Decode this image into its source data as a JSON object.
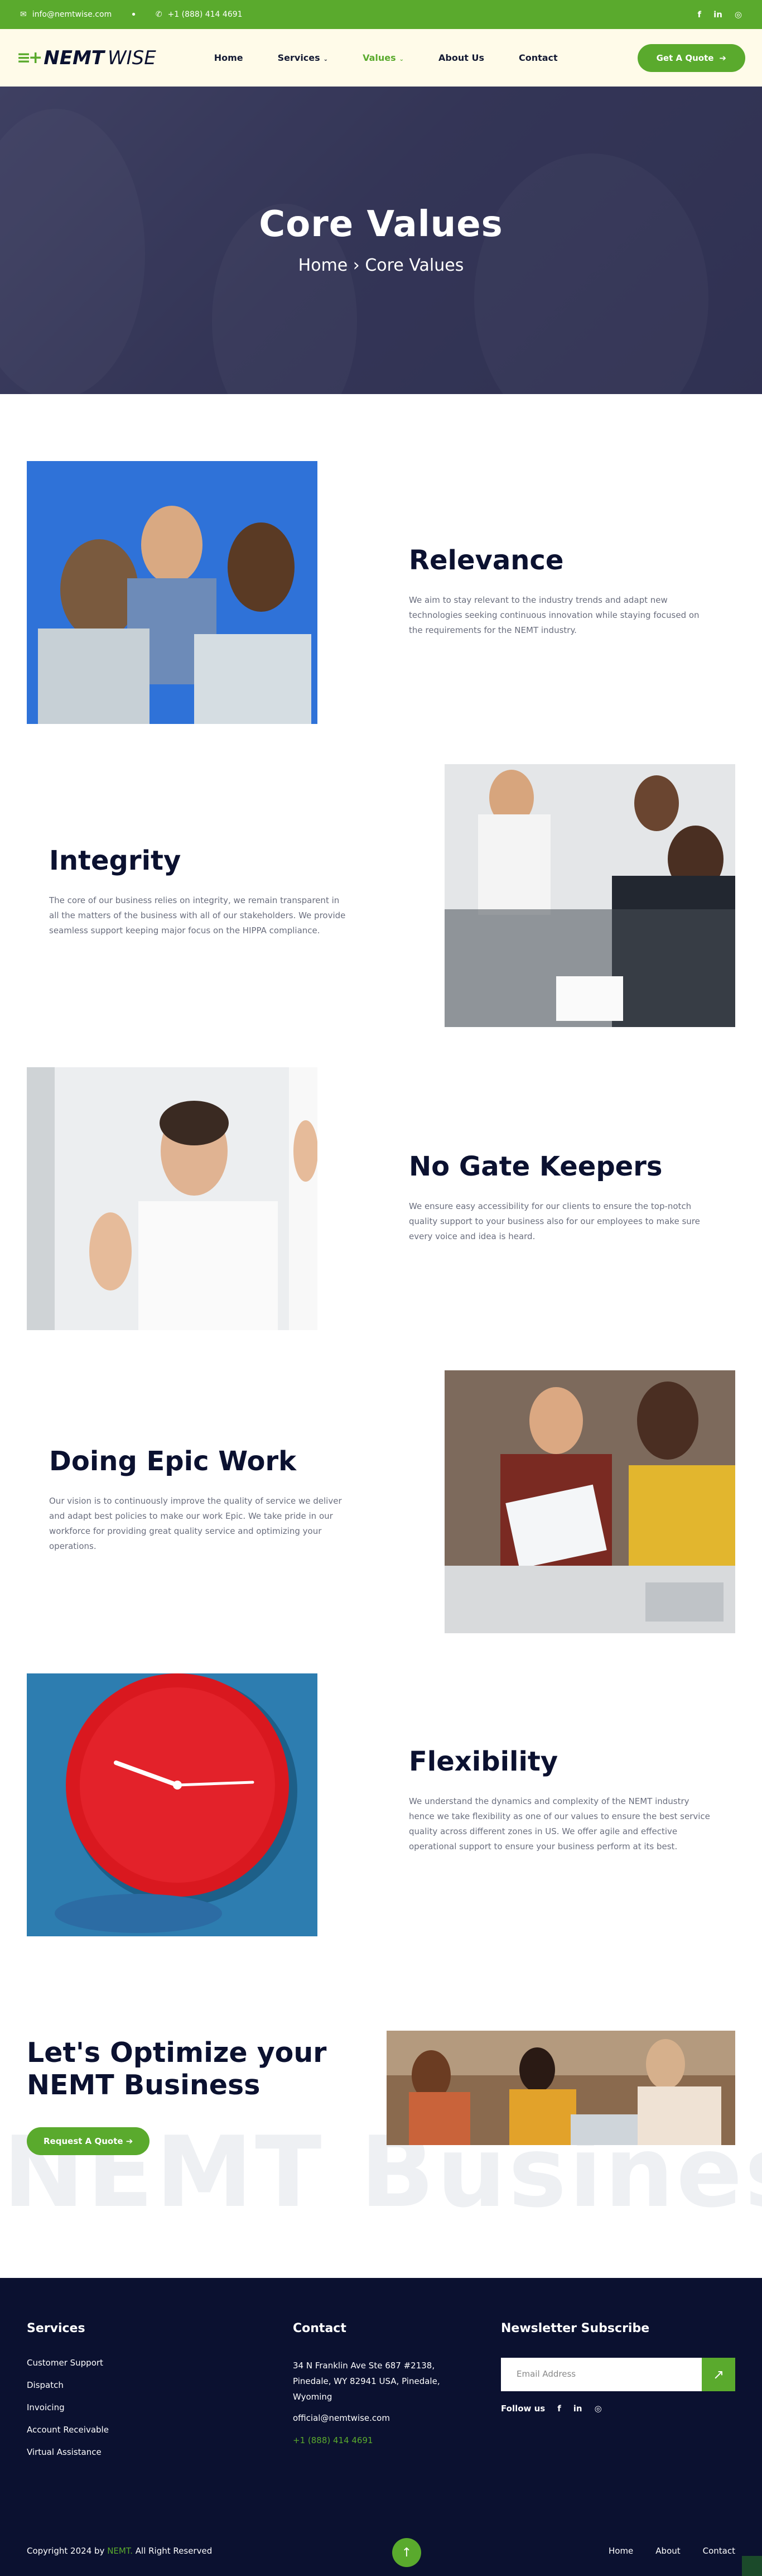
{
  "topbar": {
    "email": "info@nemtwise.com",
    "phone": "+1 (888) 414 4691",
    "socials": [
      "f",
      "in",
      "◎"
    ]
  },
  "header": {
    "logo_bold": "NEMT",
    "logo_light": "WISE",
    "nav": [
      {
        "label": "Home"
      },
      {
        "label": "Services"
      },
      {
        "label": "Values"
      },
      {
        "label": "About Us"
      },
      {
        "label": "Contact"
      }
    ],
    "cta": "Get A Quote"
  },
  "hero": {
    "title": "Core Values",
    "crumb_home": "Home",
    "crumb_current": "Core Values"
  },
  "values": [
    {
      "title": "Relevance",
      "text": "We aim to stay relevant to the industry trends and adapt new technologies seeking continuous innovation while staying focused on the requirements for the NEMT industry."
    },
    {
      "title": "Integrity",
      "text": "The core of our business relies on integrity, we remain transparent in all the matters of the business with all of our stakeholders. We provide seamless support keeping major focus on the HIPPA compliance."
    },
    {
      "title": "No Gate Keepers",
      "text": "We ensure easy accessibility for our clients to ensure the top-notch quality support to your business also for our employees to make sure every voice and idea is heard."
    },
    {
      "title": "Doing Epic Work",
      "text": "Our vision is to continuously improve the quality of service we deliver and adapt best policies to make our work Epic. We take pride in our workforce for providing great quality service and optimizing your operations."
    },
    {
      "title": "Flexibility",
      "text": "We understand the dynamics and complexity of the NEMT industry hence we take flexibility as one of our values to ensure the best service quality across different zones in US. We offer agile and effective operational support to ensure your business perform at its best."
    }
  ],
  "optimize": {
    "line1": "Let's Optimize your",
    "line2": "NEMT Business",
    "button": "Request A Quote",
    "ghost": "NEMT Business"
  },
  "footer": {
    "services_title": "Services",
    "services": [
      "Customer Support",
      "Dispatch",
      "Invoicing",
      "Account Receivable",
      "Virtual Assistance"
    ],
    "contact_title": "Contact",
    "address_1": "34 N Franklin Ave Ste 687 #2138,",
    "address_2": "Pinedale, WY 82941 USA, Pinedale,",
    "address_3": "Wyoming",
    "email": "official@nemtwise.com",
    "phone": "+1 (888) 414 4691",
    "newsletter_title": "Newsletter Subscribe",
    "email_placeholder": "Email Address",
    "follow_label": "Follow us",
    "copyright_pre": "Copyright 2024 by",
    "copyright_brand": "NEMT.",
    "copyright_post": "All Right Reserved",
    "bottom_links": [
      "Home",
      "About",
      "Contact"
    ]
  }
}
